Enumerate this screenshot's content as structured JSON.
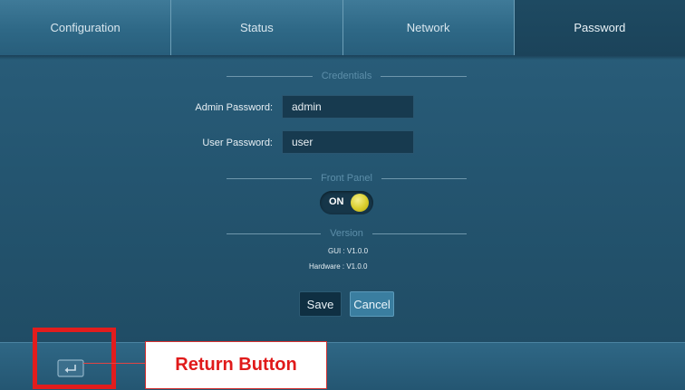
{
  "tabs": [
    {
      "label": "Configuration"
    },
    {
      "label": "Status"
    },
    {
      "label": "Network"
    },
    {
      "label": "Password"
    }
  ],
  "active_tab": "Password",
  "credentials": {
    "title": "Credentials",
    "admin_label": "Admin Password:",
    "admin_value": "admin",
    "user_label": "User Password:",
    "user_value": "user"
  },
  "front_panel": {
    "title": "Front Panel",
    "toggle_label": "ON",
    "toggle_state": true
  },
  "version": {
    "title": "Version",
    "gui": "GUI : V1.0.0",
    "hardware": "Hardware : V1.0.0"
  },
  "actions": {
    "save_label": "Save",
    "cancel_label": "Cancel"
  },
  "footer": {
    "return_icon": "return-icon"
  },
  "annotation": {
    "callout_text": "Return Button",
    "color": "#e21d1d"
  }
}
